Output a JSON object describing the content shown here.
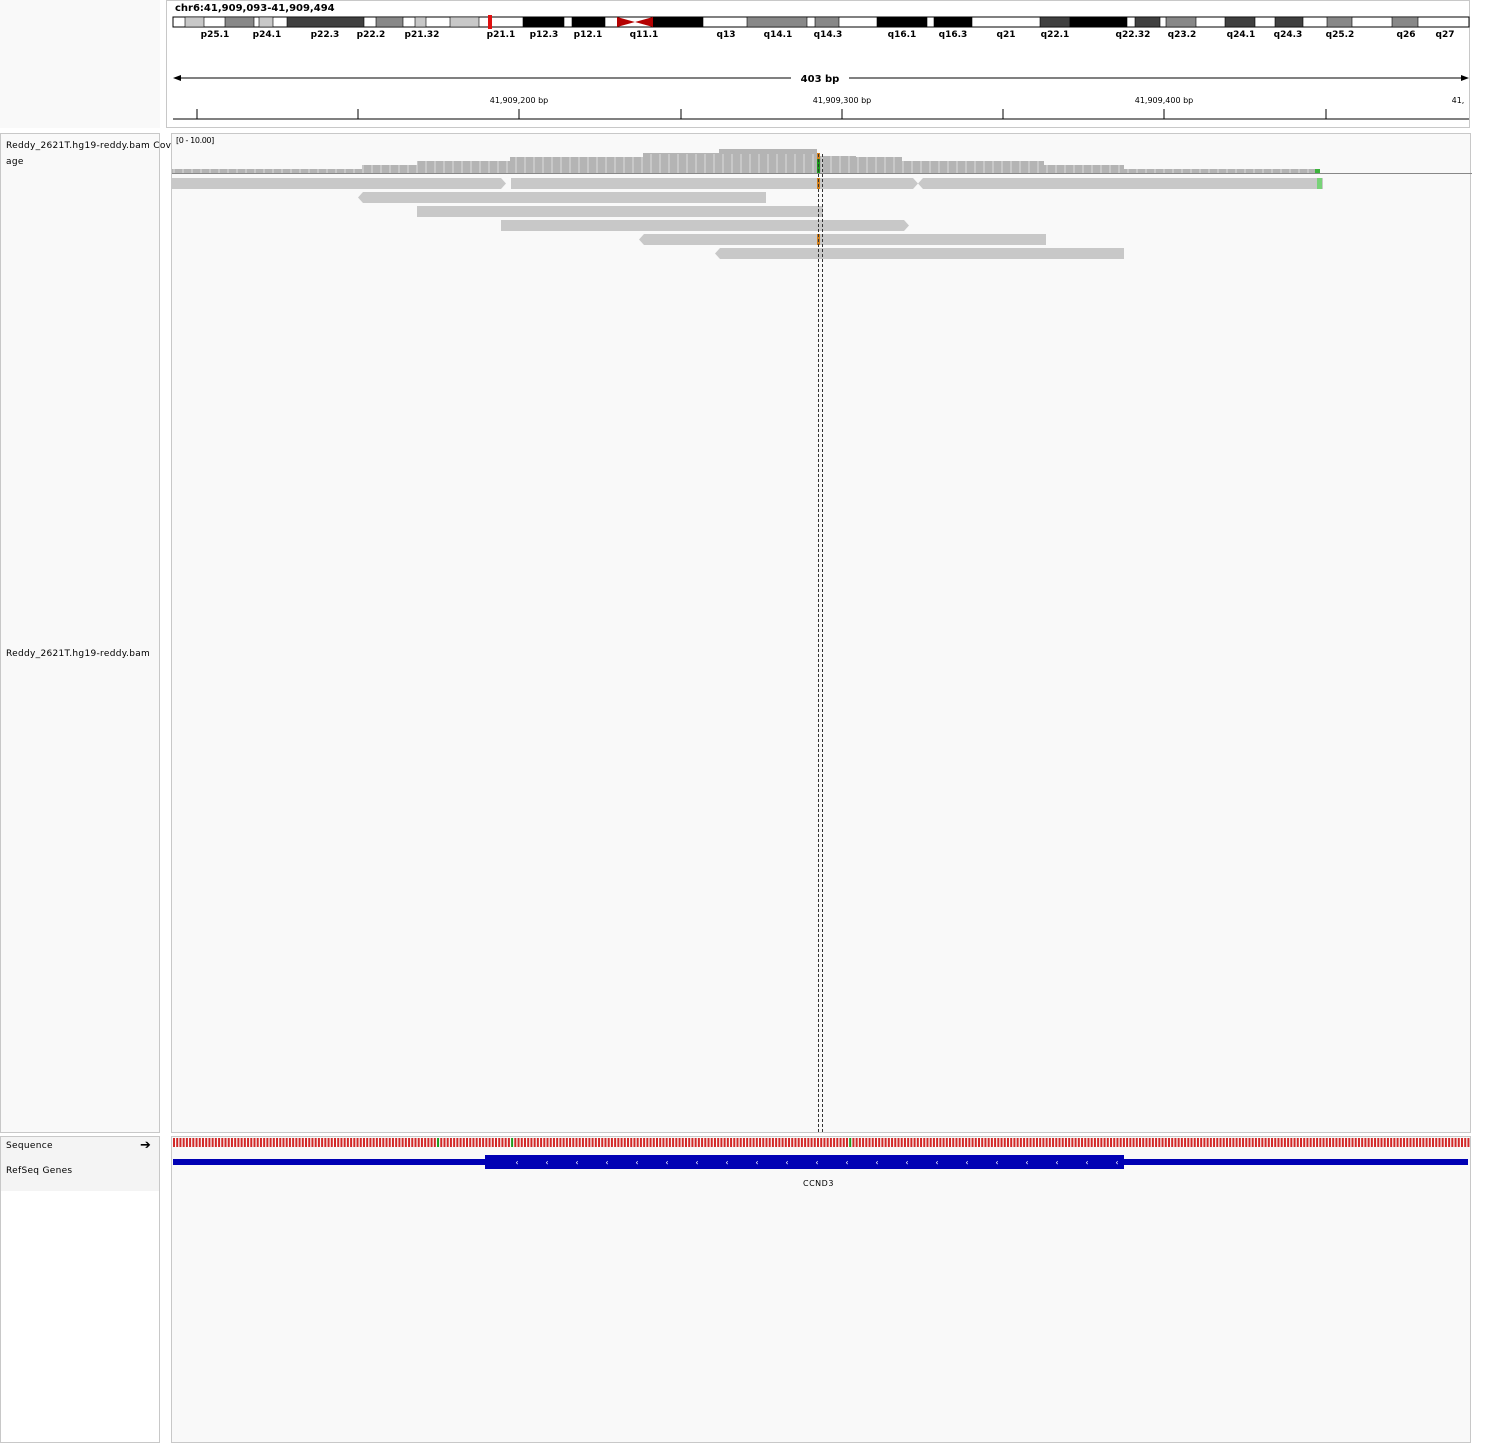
{
  "locus": "chr6:41,909,093-41,909,494",
  "span_label": "403 bp",
  "cytobands": [
    "p25.1",
    "p24.1",
    "p22.3",
    "p22.2",
    "p21.32",
    "p21.1",
    "p12.3",
    "p12.1",
    "q11.1",
    "q13",
    "q14.1",
    "q14.3",
    "q16.1",
    "q16.3",
    "q21",
    "q22.1",
    "q22.32",
    "q23.2",
    "q24.1",
    "q24.3",
    "q25.2",
    "q26",
    "q27"
  ],
  "ruler_ticks": [
    "41,909,200 bp",
    "41,909,300 bp",
    "41,909,400 bp",
    "41,"
  ],
  "tracks": {
    "coverage_name": "Reddy_2621T.hg19-reddy.bam Coverage",
    "coverage_name_line1": "Reddy_2621T.hg19-reddy.bam Cov",
    "coverage_name_line2": "age",
    "coverage_range": "[0 - 10.00]",
    "alignment_name": "Reddy_2621T.hg19-reddy.bam",
    "sequence_name": "Sequence",
    "genes_name": "RefSeq Genes",
    "gene_symbol": "CCND3"
  },
  "colors": {
    "read": "#c8c8c8",
    "coverage": "#b4b4b4",
    "gene": "#0000b4",
    "centromere": "#b40000",
    "highlight": "#e01010",
    "mismatch_orange": "#d2801e",
    "mismatch_green": "#1e9a1e"
  }
}
